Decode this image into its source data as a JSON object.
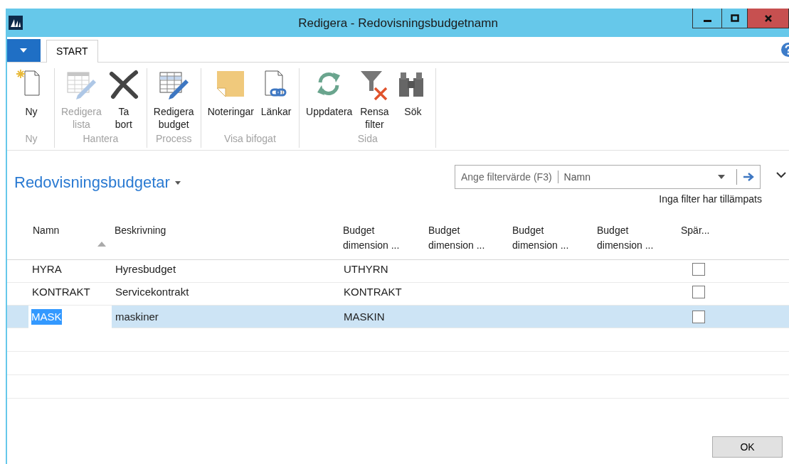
{
  "window": {
    "title": "Redigera - Redovisningsbudgetnamn"
  },
  "ribbon": {
    "tabs": [
      {
        "label": "START",
        "selected": true
      }
    ],
    "groups": [
      {
        "label": "Ny",
        "items": [
          {
            "label": "Ny",
            "disabled": false
          }
        ]
      },
      {
        "label": "Hantera",
        "items": [
          {
            "label": "Redigera\nlista",
            "disabled": true
          },
          {
            "label": "Ta\nbort",
            "disabled": false
          }
        ]
      },
      {
        "label": "Process",
        "items": [
          {
            "label": "Redigera\nbudget",
            "disabled": false
          }
        ]
      },
      {
        "label": "Visa bifogat",
        "items": [
          {
            "label": "Noteringar",
            "disabled": false
          },
          {
            "label": "Länkar",
            "disabled": false
          }
        ]
      },
      {
        "label": "Sida",
        "items": [
          {
            "label": "Uppdatera",
            "disabled": false
          },
          {
            "label": "Rensa\nfilter",
            "disabled": false
          },
          {
            "label": "Sök",
            "disabled": false
          }
        ]
      }
    ]
  },
  "list": {
    "title": "Redovisningsbudgetar",
    "filter": {
      "placeholder": "Ange filtervärde (F3)",
      "field": "Namn"
    },
    "filter_status": "Inga filter har tillämpats",
    "columns": [
      {
        "label": "Namn",
        "sorted": true
      },
      {
        "label": "Beskrivning",
        "sorted": false
      },
      {
        "label": "Budget\ndimension ...",
        "sorted": false
      },
      {
        "label": "Budget\ndimension ...",
        "sorted": false
      },
      {
        "label": "Budget\ndimension ...",
        "sorted": false
      },
      {
        "label": "Budget\ndimension ...",
        "sorted": false
      },
      {
        "label": "Spär...",
        "sorted": false
      }
    ],
    "rows": [
      {
        "name": "HYRA",
        "description": "Hyresbudget",
        "dimension_1": "UTHYRN",
        "blocked": false,
        "selected": false
      },
      {
        "name": "KONTRAKT",
        "description": "Servicekontrakt",
        "dimension_1": "KONTRAKT",
        "blocked": false,
        "selected": false
      },
      {
        "name": "MASK",
        "description": "maskiner",
        "dimension_1": "MASKIN",
        "blocked": false,
        "selected": true
      }
    ]
  },
  "buttons": [
    "OK"
  ]
}
